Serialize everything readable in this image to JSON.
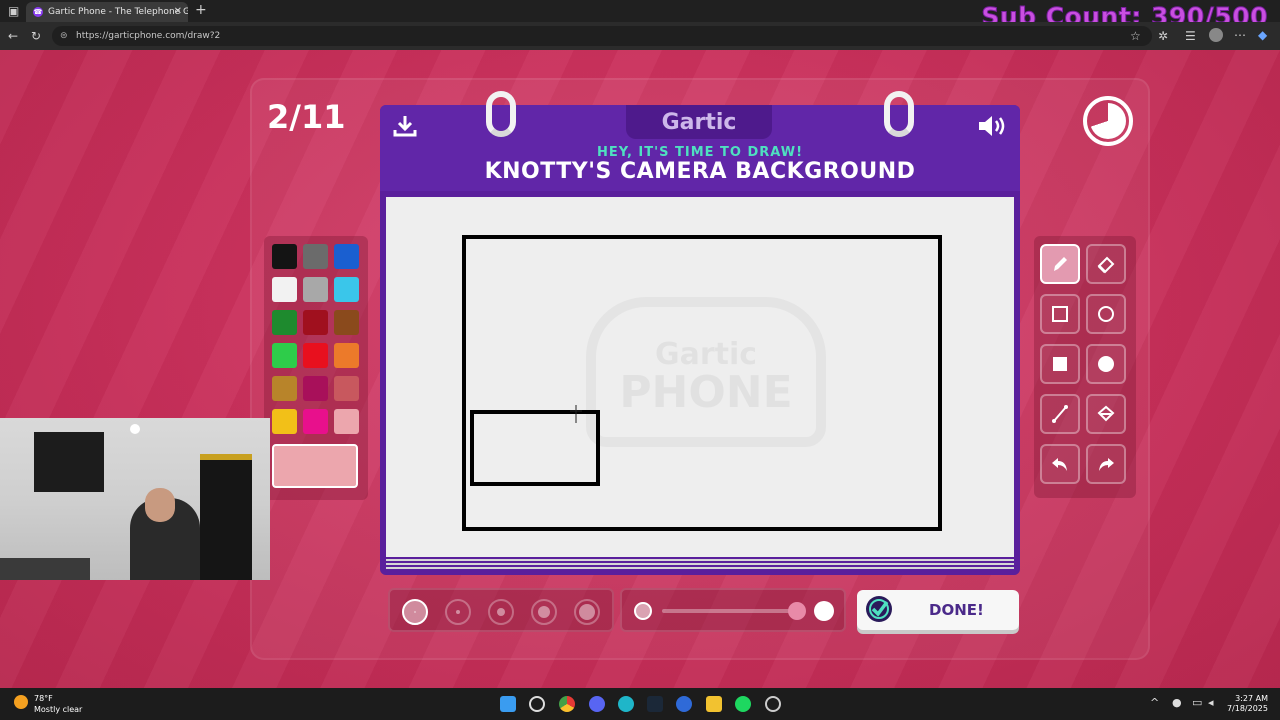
{
  "browser": {
    "tab_title": "Gartic Phone - The Telephone Ga",
    "url": "https://garticphone.com/draw?2"
  },
  "overlay": {
    "sub_count": "Sub Count: 390/500"
  },
  "game": {
    "round": "2/11",
    "logo": "Gartic",
    "subtitle": "HEY, IT'S TIME TO DRAW!",
    "prompt": "KNOTTY'S CAMERA BACKGROUND",
    "watermark_top": "Gartic",
    "watermark_bottom": "PHONE",
    "done_label": "DONE!",
    "timer_remaining_fraction": 0.7,
    "selected_color": "#eca6ad",
    "palette": [
      "#141414",
      "#6b6b6b",
      "#1a5fd0",
      "#f2f2f2",
      "#a8a8a8",
      "#3ac6ea",
      "#1e8a2e",
      "#a0101e",
      "#8a4a1c",
      "#2ecc4a",
      "#e8101e",
      "#ec7a2a",
      "#b8842a",
      "#a8105a",
      "#c8585e",
      "#f2c018",
      "#e8108c",
      "#eca6ad"
    ],
    "tools": [
      "pencil-tool",
      "eraser-tool",
      "rectangle-outline-tool",
      "ellipse-outline-tool",
      "rectangle-fill-tool",
      "ellipse-fill-tool",
      "line-tool",
      "fill-bucket-tool",
      "undo-tool",
      "redo-tool"
    ],
    "active_tool": "pencil-tool",
    "brush_sizes": 5,
    "selected_brush_size": 1
  },
  "taskbar": {
    "weather_temp": "78°F",
    "weather_desc": "Mostly clear",
    "time": "3:27 AM",
    "date": "7/18/2025"
  }
}
